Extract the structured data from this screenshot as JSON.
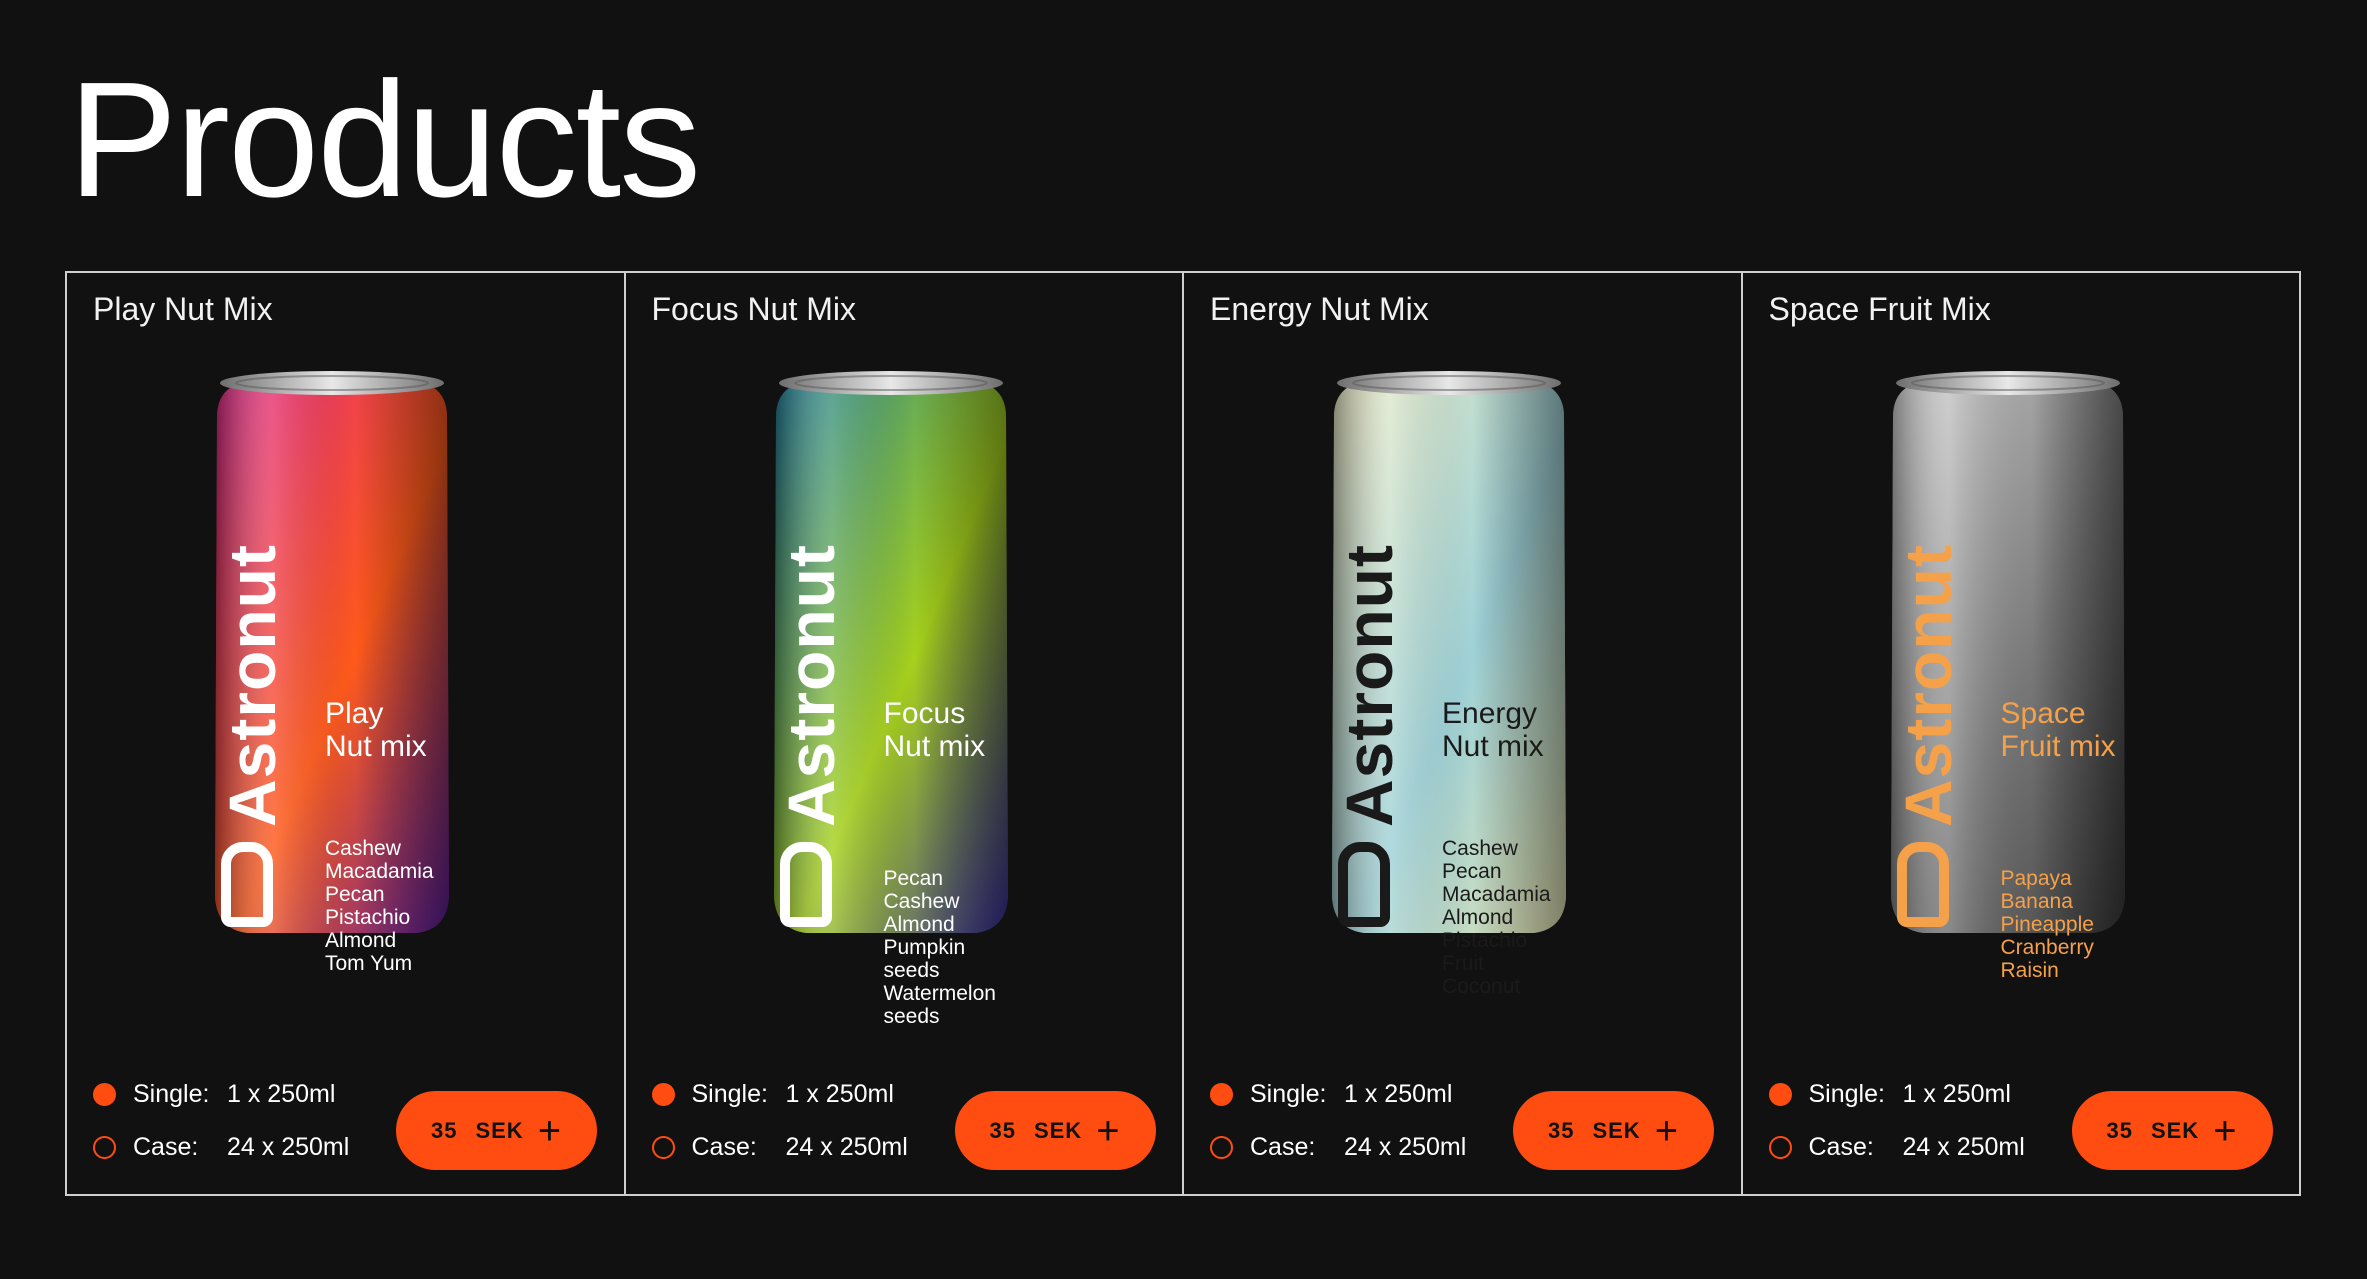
{
  "page": {
    "title": "Products"
  },
  "accent_color": "#ff4d12",
  "products": [
    {
      "name": "Play Nut Mix",
      "can": {
        "brand": "Astronut",
        "flavor_line1": "Play",
        "flavor_line2": "Nut mix",
        "ingredients": "Cashew\nMacadamia\nPecan\nPistachio\nAlmond\nTom Yum",
        "colors": [
          "#e0248a",
          "#ff5a1a",
          "#5b1f9e"
        ],
        "text_color": "#ffffff"
      },
      "options": {
        "single_label": "Single:",
        "single_value": "1 x 250ml",
        "case_label": "Case:",
        "case_value": "24 x 250ml",
        "selected": "single"
      },
      "price": {
        "amount": "35",
        "currency": "SEK"
      }
    },
    {
      "name": "Focus Nut Mix",
      "can": {
        "brand": "Astronut",
        "flavor_line1": "Focus",
        "flavor_line2": "Nut mix",
        "ingredients": "Pecan\nCashew\nAlmond\nPumpkin seeds\nWatermelon seeds",
        "colors": [
          "#1a7ea0",
          "#a6d11c",
          "#3a2e9e"
        ],
        "text_color": "#ffffff"
      },
      "options": {
        "single_label": "Single:",
        "single_value": "1 x 250ml",
        "case_label": "Case:",
        "case_value": "24 x 250ml",
        "selected": "single"
      },
      "price": {
        "amount": "35",
        "currency": "SEK"
      }
    },
    {
      "name": "Energy Nut Mix",
      "can": {
        "brand": "Astronut",
        "flavor_line1": "Energy",
        "flavor_line2": "Nut mix",
        "ingredients": "Cashew\nPecan\nMacadamia\nAlmond\nPistachio\nFruit\nCoconut",
        "colors": [
          "#f1efc8",
          "#9fd2d8",
          "#e8e6b4"
        ],
        "text_color": "#1a1a1a"
      },
      "options": {
        "single_label": "Single:",
        "single_value": "1 x 250ml",
        "case_label": "Case:",
        "case_value": "24 x 250ml",
        "selected": "single"
      },
      "price": {
        "amount": "35",
        "currency": "SEK"
      }
    },
    {
      "name": "Space Fruit Mix",
      "can": {
        "brand": "Astronut",
        "flavor_line1": "Space",
        "flavor_line2": "Fruit mix",
        "ingredients": "Papaya\nBanana\nPineapple\nCranberry\nRaisin",
        "colors": [
          "#d9d9d9",
          "#7a7a7a",
          "#3c3c3c"
        ],
        "text_color": "#f5a14a"
      },
      "options": {
        "single_label": "Single:",
        "single_value": "1 x 250ml",
        "case_label": "Case:",
        "case_value": "24 x 250ml",
        "selected": "single"
      },
      "price": {
        "amount": "35",
        "currency": "SEK"
      }
    }
  ]
}
